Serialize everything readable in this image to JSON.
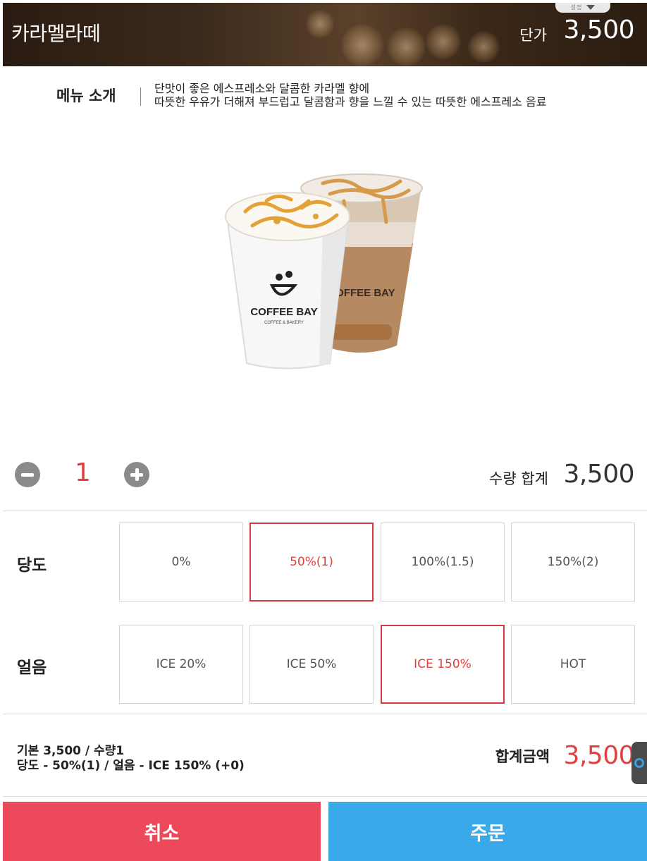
{
  "header": {
    "title": "카라멜라떼",
    "price_label": "단가",
    "price_value": "3,500",
    "dropdown_dots": "설정"
  },
  "intro": {
    "title": "메뉴 소개",
    "line1": "단맛이 좋은 에스프레소와 달콤한 카라멜 향에",
    "line2": "따뜻한 우유가 더해져 부드럽고 달콤함과 향을 느낄 수 있는 따뜻한 에스프레소 음료"
  },
  "product": {
    "brand": "COFFEE BAY",
    "brand_sub": "COFFEE & BAKERY"
  },
  "quantity": {
    "value": "1",
    "total_label": "수량 합계",
    "total_value": "3,500"
  },
  "options": {
    "sweetness": {
      "label": "당도",
      "choices": [
        "0%",
        "50%(1)",
        "100%(1.5)",
        "150%(2)"
      ],
      "selected": "50%(1)"
    },
    "ice": {
      "label": "얼음",
      "choices": [
        "ICE 20%",
        "ICE 50%",
        "ICE 150%",
        "HOT"
      ],
      "selected": "ICE 150%"
    }
  },
  "summary": {
    "line1": "기본 3,500 / 수량1",
    "line2": "당도 - 50%(1) / 얼음 - ICE 150%  (+0)",
    "total_label": "합계금액",
    "total_value": "3,500"
  },
  "buttons": {
    "cancel": "취소",
    "order": "주문"
  },
  "colors": {
    "accent_red": "#e0413f",
    "cancel_bg": "#ec4a5b",
    "order_bg": "#3aa9ea"
  }
}
